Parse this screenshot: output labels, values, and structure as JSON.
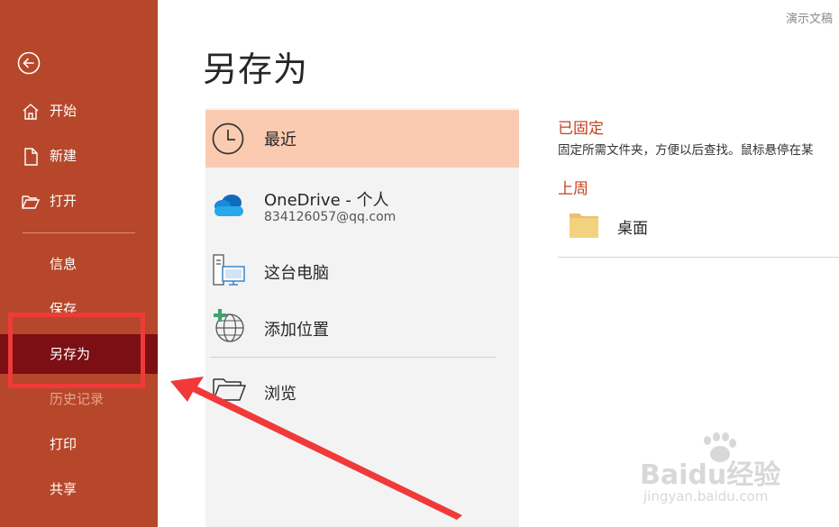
{
  "sidebar": {
    "items": [
      {
        "label": "开始",
        "icon": "home-icon"
      },
      {
        "label": "新建",
        "icon": "new-file-icon"
      },
      {
        "label": "打开",
        "icon": "open-folder-icon"
      },
      {
        "label": "信息"
      },
      {
        "label": "保存"
      },
      {
        "label": "另存为",
        "selected": true
      },
      {
        "label": "历史记录",
        "disabled": true
      },
      {
        "label": "打印"
      },
      {
        "label": "共享"
      }
    ]
  },
  "main": {
    "title": "另存为",
    "top_right_text": "演示文稿"
  },
  "locations": [
    {
      "title": "最近",
      "icon": "clock-icon",
      "active": true
    },
    {
      "title": "OneDrive - 个人",
      "subtitle": "834126057@qq.com",
      "icon": "onedrive-cloud-icon"
    },
    {
      "title": "这台电脑",
      "icon": "this-pc-icon"
    },
    {
      "title": "添加位置",
      "icon": "add-location-globe-icon"
    },
    {
      "title": "浏览",
      "icon": "browse-folder-icon"
    }
  ],
  "right": {
    "pinned_heading": "已固定",
    "pinned_desc": "固定所需文件夹，方便以后查找。鼠标悬停在某",
    "last_week_heading": "上周",
    "folders": [
      {
        "name": "桌面",
        "icon": "folder-icon"
      }
    ]
  },
  "watermark": {
    "brand": "Baidu经验",
    "url": "jingyan.baidu.com"
  },
  "colors": {
    "sidebar": "#b7472a",
    "selected": "#7b0f14",
    "active_location": "#fbcbb1",
    "heading": "#c4401f",
    "annotation": "#f03a3a"
  }
}
